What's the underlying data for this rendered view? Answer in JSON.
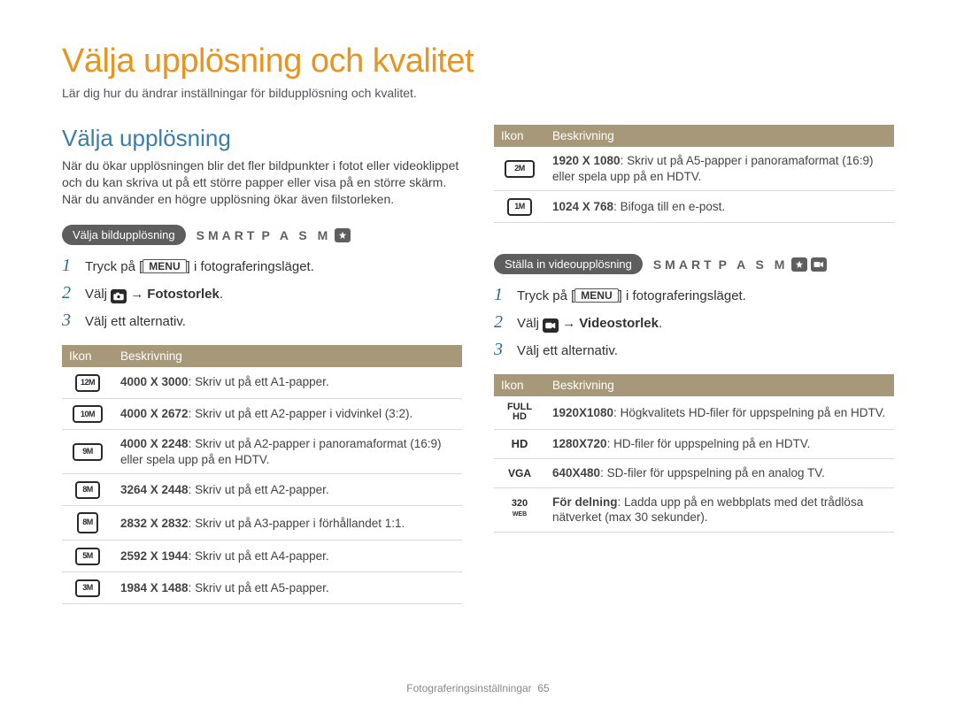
{
  "page_title": "Välja upplösning och kvalitet",
  "page_subtitle": "Lär dig hur du ändrar inställningar för bildupplösning och kvalitet.",
  "section_title": "Välja upplösning",
  "section_para": "När du ökar upplösningen blir det fler bildpunkter i fotot eller videoklippet och du kan skriva ut på ett större papper eller visa på en större skärm. När du använder en högre upplösning ökar även filstorleken.",
  "table_headers": {
    "icon": "Ikon",
    "desc": "Beskrivning"
  },
  "modes_label_smart": "SMART",
  "modes_letters": "P A S M",
  "menu_key": "MENU",
  "arrow": "→",
  "photo": {
    "pill": "Välja bildupplösning",
    "steps": {
      "s1_a": "Tryck på [",
      "s1_b": "] i fotograferingsläget.",
      "s2_a": "Välj ",
      "s2_b": "Fotostorlek",
      "s2_c": ".",
      "s3": "Välj ett alternativ."
    },
    "rows": [
      {
        "icon": "12M",
        "res": "4000 X 3000",
        "desc": ": Skriv ut på ett A1-papper."
      },
      {
        "icon": "10M",
        "res": "4000 X 2672",
        "desc": ": Skriv ut på ett A2-papper i vidvinkel (3:2)."
      },
      {
        "icon": "9M",
        "res": "4000 X 2248",
        "desc": ": Skriv ut på A2-papper i panoramaformat (16:9) eller spela upp på en HDTV."
      },
      {
        "icon": "8M",
        "res": "3264 X 2448",
        "desc": ": Skriv ut på ett A2-papper."
      },
      {
        "icon": "8M",
        "res": "2832 X 2832",
        "desc": ": Skriv ut på A3-papper i förhållandet 1:1."
      },
      {
        "icon": "5M",
        "res": "2592 X 1944",
        "desc": ": Skriv ut på ett A4-papper."
      },
      {
        "icon": "3M",
        "res": "1984 X 1488",
        "desc": ": Skriv ut på ett A5-papper."
      }
    ]
  },
  "photo_extra_rows": [
    {
      "icon": "2M",
      "res": "1920 X 1080",
      "desc": ": Skriv ut på A5-papper i panoramaformat (16:9) eller spela upp på en HDTV."
    },
    {
      "icon": "1M",
      "res": "1024 X 768",
      "desc": ": Bifoga till en e-post."
    }
  ],
  "video": {
    "pill": "Ställa in videoupplösning",
    "steps": {
      "s1_a": "Tryck på [",
      "s1_b": "] i fotograferingsläget.",
      "s2_a": "Välj ",
      "s2_b": "Videostorlek",
      "s2_c": ".",
      "s3": "Välj ett alternativ."
    },
    "rows": [
      {
        "icon": "FULL HD",
        "res": "1920X1080",
        "desc": ": Högkvalitets HD-filer för uppspelning på en HDTV."
      },
      {
        "icon": "HD",
        "res": "1280X720",
        "desc": ": HD-filer för uppspelning på en HDTV."
      },
      {
        "icon": "VGA",
        "res": "640X480",
        "desc": ": SD-filer för uppspelning på en analog TV."
      },
      {
        "icon": "320",
        "res": "För delning",
        "desc": ": Ladda upp på en webbplats med det trådlösa nätverket (max 30 sekunder)."
      }
    ]
  },
  "footer": {
    "section": "Fotograferingsinställningar",
    "page_num": "65"
  }
}
